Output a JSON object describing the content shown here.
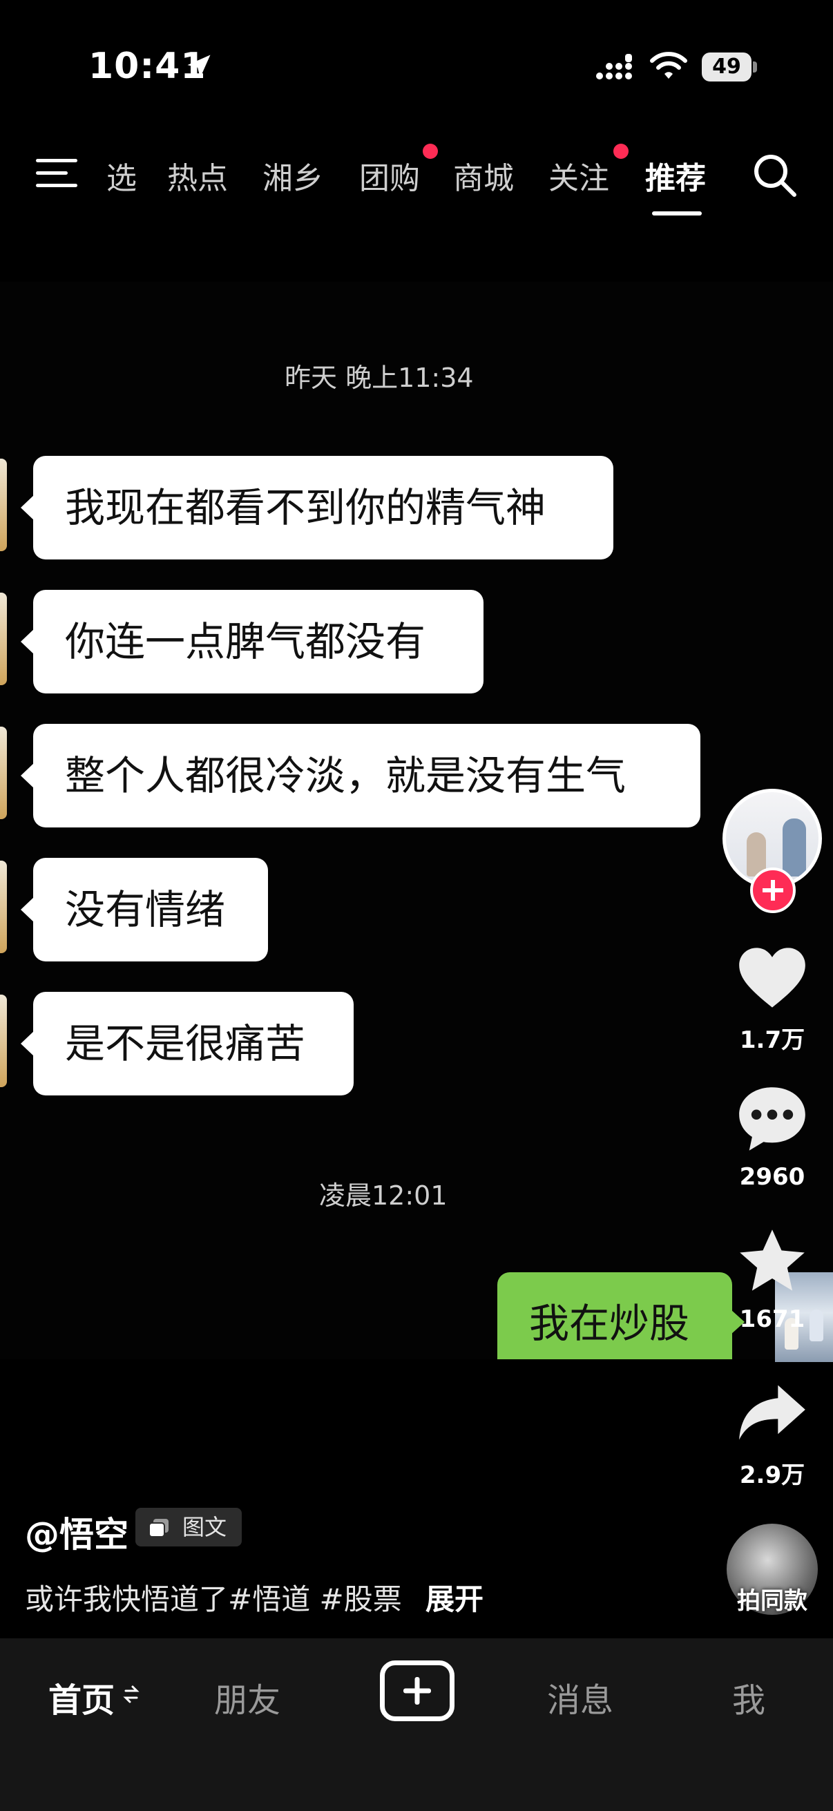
{
  "status_bar": {
    "time": "10:41",
    "battery": "49"
  },
  "top_nav": {
    "tabs": [
      {
        "label": "选"
      },
      {
        "label": "热点"
      },
      {
        "label": "湘乡"
      },
      {
        "label": "团购",
        "dot": true
      },
      {
        "label": "商城"
      },
      {
        "label": "关注",
        "dot": true
      },
      {
        "label": "推荐",
        "active": true
      }
    ]
  },
  "chat": {
    "timestamp_1": "昨天 晚上11:34",
    "messages_left": [
      "我现在都看不到你的精气神",
      "你连一点脾气都没有",
      "整个人都很冷淡，就是没有生气",
      "没有情绪",
      "是不是很痛苦"
    ],
    "timestamp_2": "凌晨12:01",
    "message_right": "我在炒股"
  },
  "actions": {
    "likes": "1.7万",
    "comments": "2960",
    "favorites": "1671",
    "shares": "2.9万",
    "same_style": "拍同款"
  },
  "post": {
    "author": "@悟空",
    "badge": "图文",
    "caption": "或许我快悟道了#悟道 #股票",
    "expand": "展开"
  },
  "bottom_nav": {
    "home": "首页",
    "friends": "朋友",
    "messages": "消息",
    "me": "我"
  },
  "colors": {
    "accent": "#fe2c55",
    "bubble_green": "#7ccb4c"
  }
}
